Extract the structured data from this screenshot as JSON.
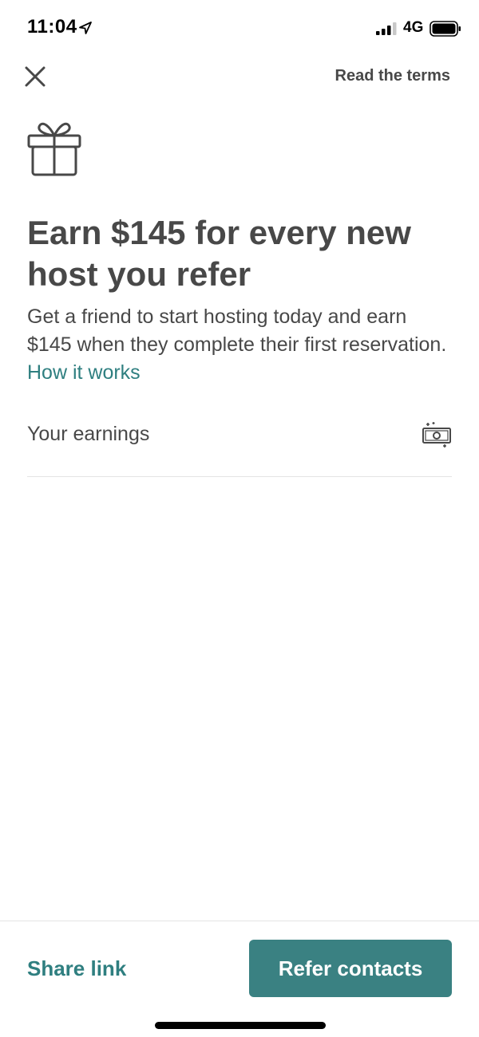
{
  "status_bar": {
    "time": "11:04",
    "network": "4G",
    "icons": [
      "location-arrow-icon",
      "signal-bars-icon",
      "battery-icon"
    ]
  },
  "header": {
    "close_icon": "close-icon",
    "terms_link": "Read the terms"
  },
  "hero": {
    "icon": "gift-icon",
    "headline": "Earn $145 for every new host you refer",
    "description": "Get a friend to start hosting today and earn $145 when they complete their first reservation.",
    "how_it_works": "How it works"
  },
  "earnings": {
    "label": "Your earnings",
    "icon": "money-bill-icon"
  },
  "footer": {
    "share_link": "Share link",
    "refer_button": "Refer contacts"
  },
  "colors": {
    "accent": "#3a8182",
    "link": "#2f7f80",
    "text": "#484848",
    "divider": "#e4e4e4"
  }
}
